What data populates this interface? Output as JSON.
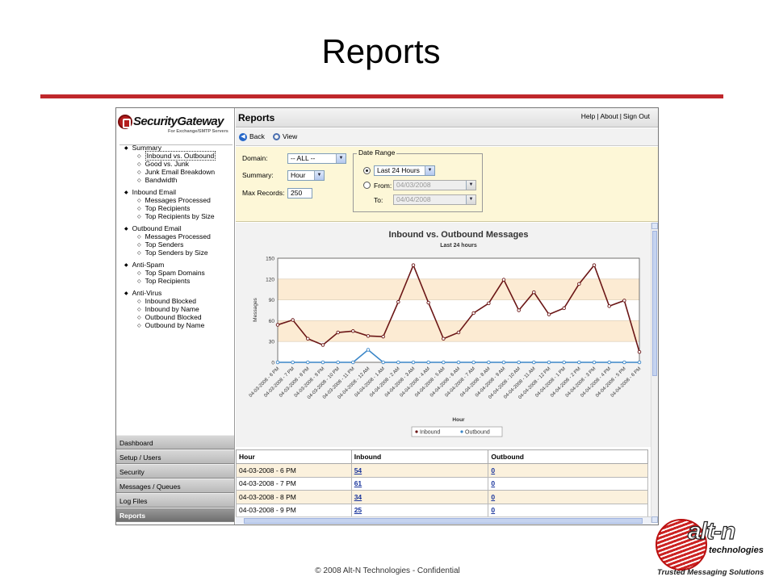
{
  "slide": {
    "title": "Reports",
    "footer": "© 2008 Alt-N Technologies - Confidential",
    "accent": "#c0282c"
  },
  "brand": {
    "name": "SecurityGateway",
    "subtitle": "For Exchange/SMTP Servers"
  },
  "sidebar": {
    "groups": [
      {
        "title": "Summary",
        "items": [
          "Inbound vs. Outbound",
          "Good vs. Junk",
          "Junk Email Breakdown",
          "Bandwidth"
        ],
        "active": 0
      },
      {
        "title": "Inbound Email",
        "items": [
          "Messages Processed",
          "Top Recipients",
          "Top Recipients by Size"
        ]
      },
      {
        "title": "Outbound Email",
        "items": [
          "Messages Processed",
          "Top Senders",
          "Top Senders by Size"
        ]
      },
      {
        "title": "Anti-Spam",
        "items": [
          "Top Spam Domains",
          "Top Recipients"
        ]
      },
      {
        "title": "Anti-Virus",
        "items": [
          "Inbound Blocked",
          "Inbound by Name",
          "Outbound Blocked",
          "Outbound by Name"
        ]
      }
    ],
    "menu": [
      "Dashboard",
      "Setup / Users",
      "Security",
      "Messages / Queues",
      "Log Files",
      "Reports"
    ],
    "active_menu": "Reports"
  },
  "header": {
    "title": "Reports",
    "links": [
      "Help",
      "About",
      "Sign Out"
    ]
  },
  "toolbar": {
    "back_label": "Back",
    "view_label": "View"
  },
  "filters": {
    "domain_label": "Domain:",
    "domain_value": "-- ALL --",
    "summary_label": "Summary:",
    "summary_value": "Hour",
    "max_label": "Max Records:",
    "max_value": "250",
    "date_range_label": "Date Range",
    "range_value": "Last 24 Hours",
    "from_label": "From:",
    "from_value": "04/03/2008",
    "to_label": "To:",
    "to_value": "04/04/2008"
  },
  "chart_data": {
    "type": "line",
    "title": "Inbound vs. Outbound Messages",
    "subtitle": "Last 24 hours",
    "xlabel": "Hour",
    "ylabel": "Messages",
    "ylim": [
      0,
      150
    ],
    "yticks": [
      0,
      30,
      60,
      90,
      120,
      150
    ],
    "categories": [
      "04-03-2008 - 6 PM",
      "04-03-2008 - 7 PM",
      "04-03-2008 - 8 PM",
      "04-03-2008 - 9 PM",
      "04-03-2008 - 10 PM",
      "04-03-2008 - 11 PM",
      "04-04-2008 - 12 AM",
      "04-04-2008 - 1 AM",
      "04-04-2008 - 2 AM",
      "04-04-2008 - 3 AM",
      "04-04-2008 - 4 AM",
      "04-04-2008 - 5 AM",
      "04-04-2008 - 6 AM",
      "04-04-2008 - 7 AM",
      "04-04-2008 - 8 AM",
      "04-04-2008 - 9 AM",
      "04-04-2008 - 10 AM",
      "04-04-2008 - 11 AM",
      "04-04-2008 - 12 PM",
      "04-04-2008 - 1 PM",
      "04-04-2008 - 2 PM",
      "04-04-2008 - 3 PM",
      "04-04-2008 - 4 PM",
      "04-04-2008 - 5 PM",
      "04-04-2008 - 6 PM"
    ],
    "series": [
      {
        "name": "Inbound",
        "color": "#6b1616",
        "values": [
          54,
          61,
          34,
          25,
          43,
          45,
          38,
          37,
          87,
          140,
          86,
          34,
          43,
          71,
          85,
          119,
          75,
          101,
          69,
          78,
          113,
          140,
          81,
          89,
          15
        ]
      },
      {
        "name": "Outbound",
        "color": "#3a86c8",
        "values": [
          0,
          0,
          0,
          0,
          0,
          0,
          18,
          0,
          0,
          0,
          0,
          0,
          0,
          0,
          0,
          0,
          0,
          0,
          0,
          0,
          0,
          0,
          0,
          0,
          0
        ]
      }
    ],
    "grid": true,
    "band_color": "#fcebd3",
    "legend": "bottom-center"
  },
  "table": {
    "columns": [
      "Hour",
      "Inbound",
      "Outbound"
    ],
    "rows": [
      [
        "04-03-2008 - 6 PM",
        "54",
        "0"
      ],
      [
        "04-03-2008 - 7 PM",
        "61",
        "0"
      ],
      [
        "04-03-2008 - 8 PM",
        "34",
        "0"
      ],
      [
        "04-03-2008 - 9 PM",
        "25",
        "0"
      ]
    ]
  },
  "logo": {
    "word": "alt-n",
    "sub": "technologies",
    "tagline": "Trusted Messaging Solutions"
  }
}
